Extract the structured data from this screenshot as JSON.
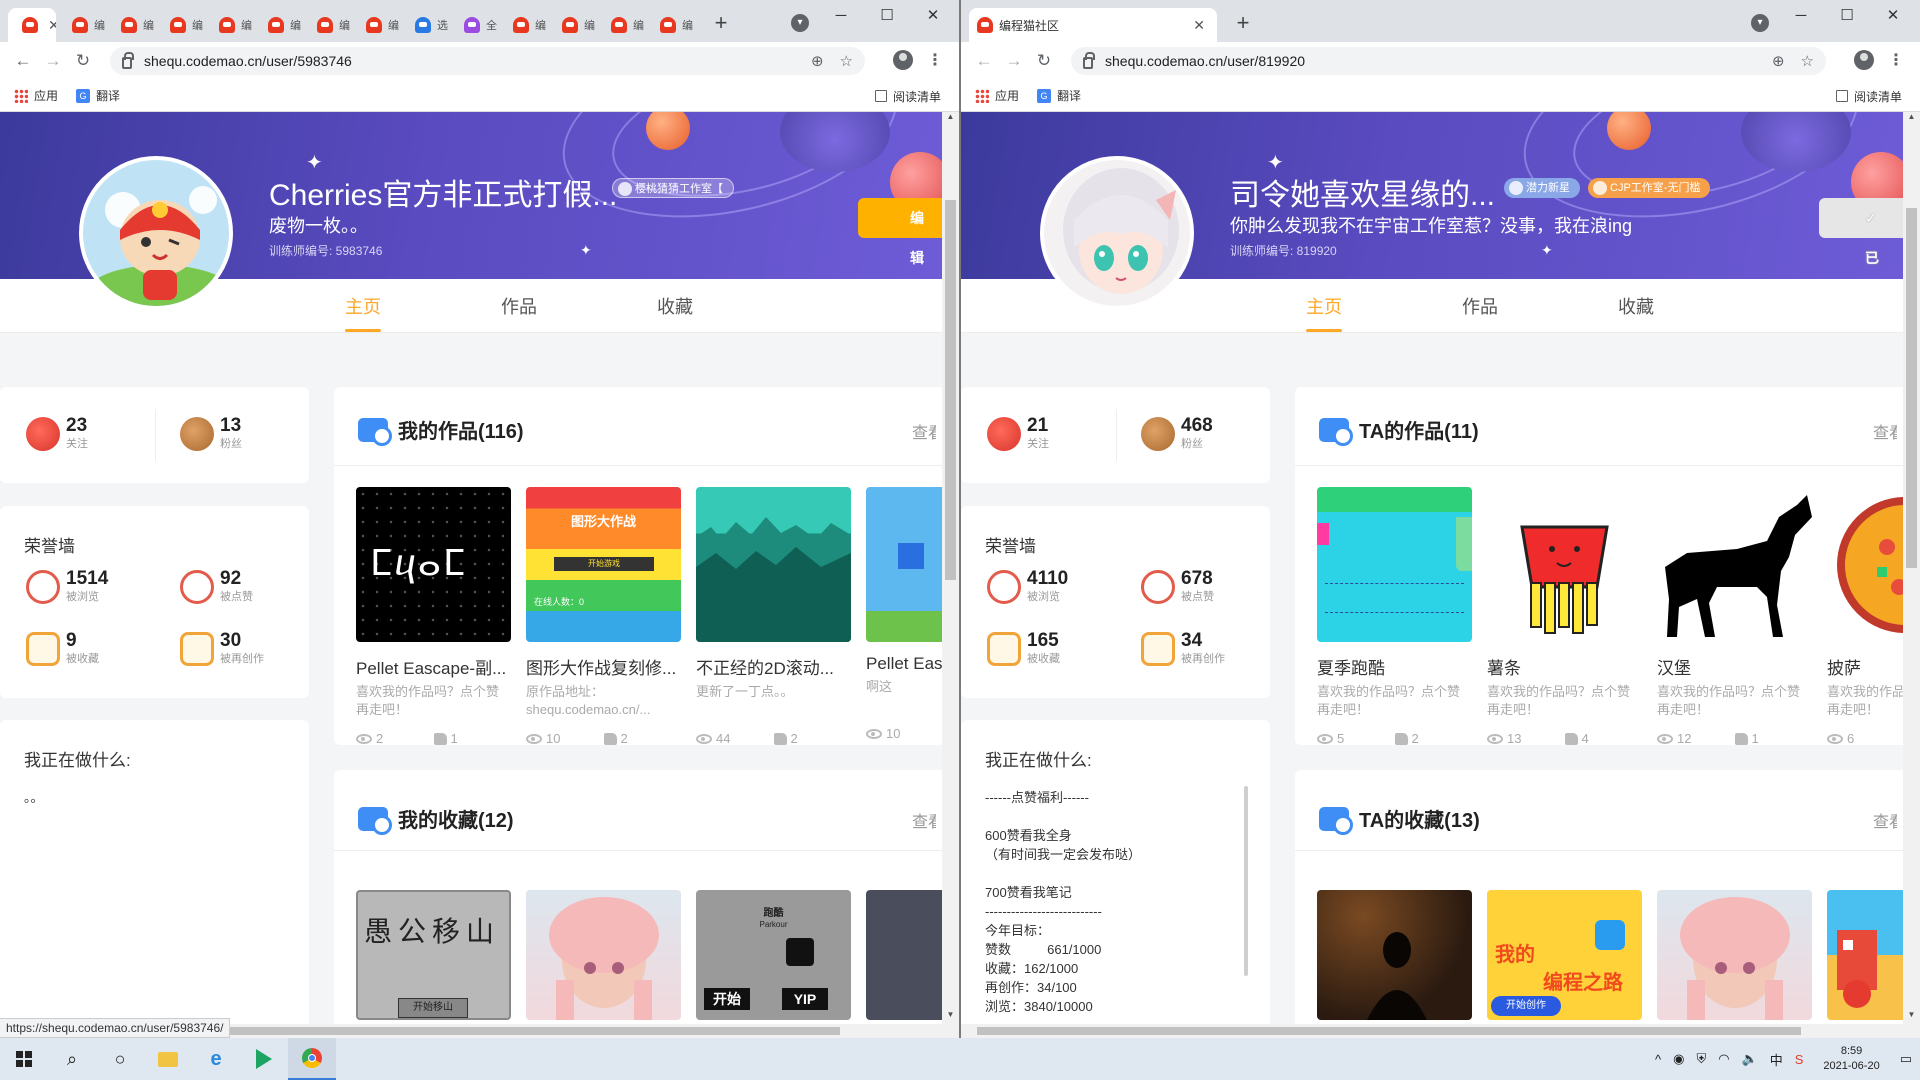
{
  "taskbar": {
    "time": "8:59",
    "date": "2021-06-20"
  },
  "status_url": "https://shequ.codemao.cn/user/5983746/",
  "left": {
    "tab_label_short": "编",
    "tab_label_alt": "选",
    "tab_label_alt2": "全",
    "url": "shequ.codemao.cn/user/5983746",
    "bookmarks": {
      "apps": "应用",
      "translate": "翻译",
      "reading_list": "阅读清单"
    },
    "profile": {
      "name": "Cherries官方非正式打假...",
      "badges": [
        "樱桃猜猜工作室【"
      ],
      "bio": "废物一枚。。",
      "id_label": "训练师编号: 5983746",
      "edit_button": "编辑"
    },
    "tabs": [
      "主页",
      "作品",
      "收藏"
    ],
    "stats": {
      "following": "23",
      "following_label": "关注",
      "followers": "13",
      "followers_label": "粉丝"
    },
    "honor": {
      "title": "荣誉墙",
      "views": "1514",
      "views_label": "被浏览",
      "likes": "92",
      "likes_label": "被点赞",
      "collects": "9",
      "collects_label": "被收藏",
      "recreate": "30",
      "recreate_label": "被再创作"
    },
    "doing": {
      "title": "我正在做什么:",
      "text": "。。"
    },
    "works": {
      "title": "我的作品(116)",
      "more": "查看",
      "items": [
        {
          "title": "Pellet Eascape-副...",
          "desc": "喜欢我的作品吗？点个赞再走吧！",
          "views": "2",
          "likes": "1"
        },
        {
          "title": "图形大作战复刻修...",
          "desc": "原作品地址：shequ.codemao.cn/...",
          "views": "10",
          "likes": "2",
          "img_title": "图形大作战",
          "img_start": "开始游戏",
          "img_count": "在线人数：0"
        },
        {
          "title": "不正经的2D滚动...",
          "desc": "更新了一丁点。。",
          "views": "44",
          "likes": "2"
        },
        {
          "title": "Pellet Eas",
          "desc": "啊这",
          "views": "10",
          "likes": ""
        }
      ],
      "first_img_text": "ⵎⴗⴰⵎ"
    },
    "collections": {
      "title": "我的收藏(12)",
      "more": "查看",
      "img1_text": "愚公移山",
      "img1_btn": "开始移山",
      "img3_title": "跑酷",
      "img3_sub": "Parkour",
      "img3_btn1": "开始",
      "img3_btn2": "YIP"
    }
  },
  "right": {
    "tab_label": "编程猫社区",
    "url": "shequ.codemao.cn/user/819920",
    "bookmarks": {
      "apps": "应用",
      "translate": "翻译",
      "reading_list": "阅读清单"
    },
    "profile": {
      "name": "司令她喜欢星缘的...",
      "badges": [
        "潜力新星",
        "CJP工作室-无门槛"
      ],
      "bio": "你肿么发现我不在宇宙工作室惹？没事，我在浪ing",
      "id_label": "训练师编号: 819920",
      "edit_button": "✓ 已关"
    },
    "tabs": [
      "主页",
      "作品",
      "收藏"
    ],
    "stats": {
      "following": "21",
      "following_label": "关注",
      "followers": "468",
      "followers_label": "粉丝"
    },
    "honor": {
      "title": "荣誉墙",
      "views": "4110",
      "views_label": "被浏览",
      "likes": "678",
      "likes_label": "被点赞",
      "collects": "165",
      "collects_label": "被收藏",
      "recreate": "34",
      "recreate_label": "被再创作"
    },
    "doing": {
      "title": "我正在做什么:",
      "text": "------点赞福利------\n\n600赞看我全身\n（有时间我一定会发布哒）\n\n700赞看我笔记\n---------------------------\n今年目标：\n赞数          661/1000\n收藏：162/1000\n再创作：34/100\n浏览：3840/10000"
    },
    "works": {
      "title": "TA的作品(11)",
      "more": "查看",
      "items": [
        {
          "title": "夏季跑酷",
          "desc": "喜欢我的作品吗？点个赞再走吧！",
          "views": "5",
          "likes": "2"
        },
        {
          "title": "薯条",
          "desc": "喜欢我的作品吗？点个赞再走吧！",
          "views": "13",
          "likes": "4"
        },
        {
          "title": "汉堡",
          "desc": "喜欢我的作品吗？点个赞再走吧！",
          "views": "12",
          "likes": "1"
        },
        {
          "title": "披萨",
          "desc": "喜欢我的作品吗？点个赞再走吧！",
          "views": "6",
          "likes": ""
        }
      ]
    },
    "collections": {
      "title": "TA的收藏(13)",
      "more": "查看",
      "img2_text1": "我的",
      "img2_text2": "编程之路",
      "img2_btn": "开始创作"
    }
  }
}
